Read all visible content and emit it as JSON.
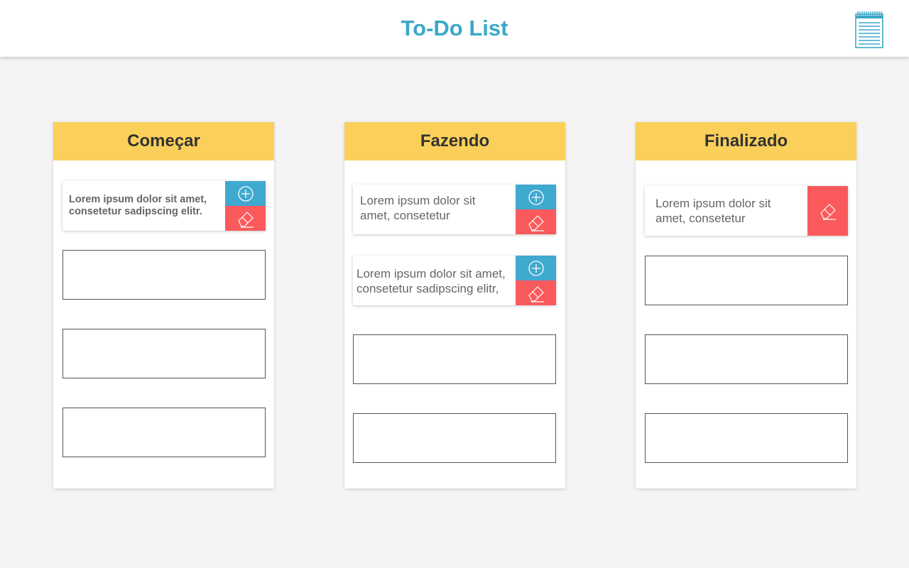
{
  "app": {
    "title": "To-Do List",
    "icon": "notepad-icon",
    "accent": "#3aa8c8"
  },
  "colors": {
    "column_header": "#fbd05a",
    "add_button": "#3fa9d0",
    "erase_button": "#fa5a5c"
  },
  "columns": [
    {
      "title": "Começar",
      "cards": [
        {
          "text": "Lorem ipsum dolor sit amet, consetetur sadipscing elitr.",
          "actions": [
            "add-icon",
            "eraser-icon"
          ]
        }
      ],
      "empty_slots": 3
    },
    {
      "title": "Fazendo",
      "cards": [
        {
          "text": "Lorem ipsum dolor sit amet, consetetur",
          "actions": [
            "add-icon",
            "eraser-icon"
          ]
        },
        {
          "text": "Lorem ipsum dolor sit amet, consetetur sadipscing elitr,",
          "actions": [
            "add-icon",
            "eraser-icon"
          ]
        }
      ],
      "empty_slots": 2
    },
    {
      "title": "Finalizado",
      "cards": [
        {
          "text": "Lorem ipsum dolor sit amet, consetetur",
          "actions": [
            "eraser-icon"
          ]
        }
      ],
      "empty_slots": 3
    }
  ]
}
